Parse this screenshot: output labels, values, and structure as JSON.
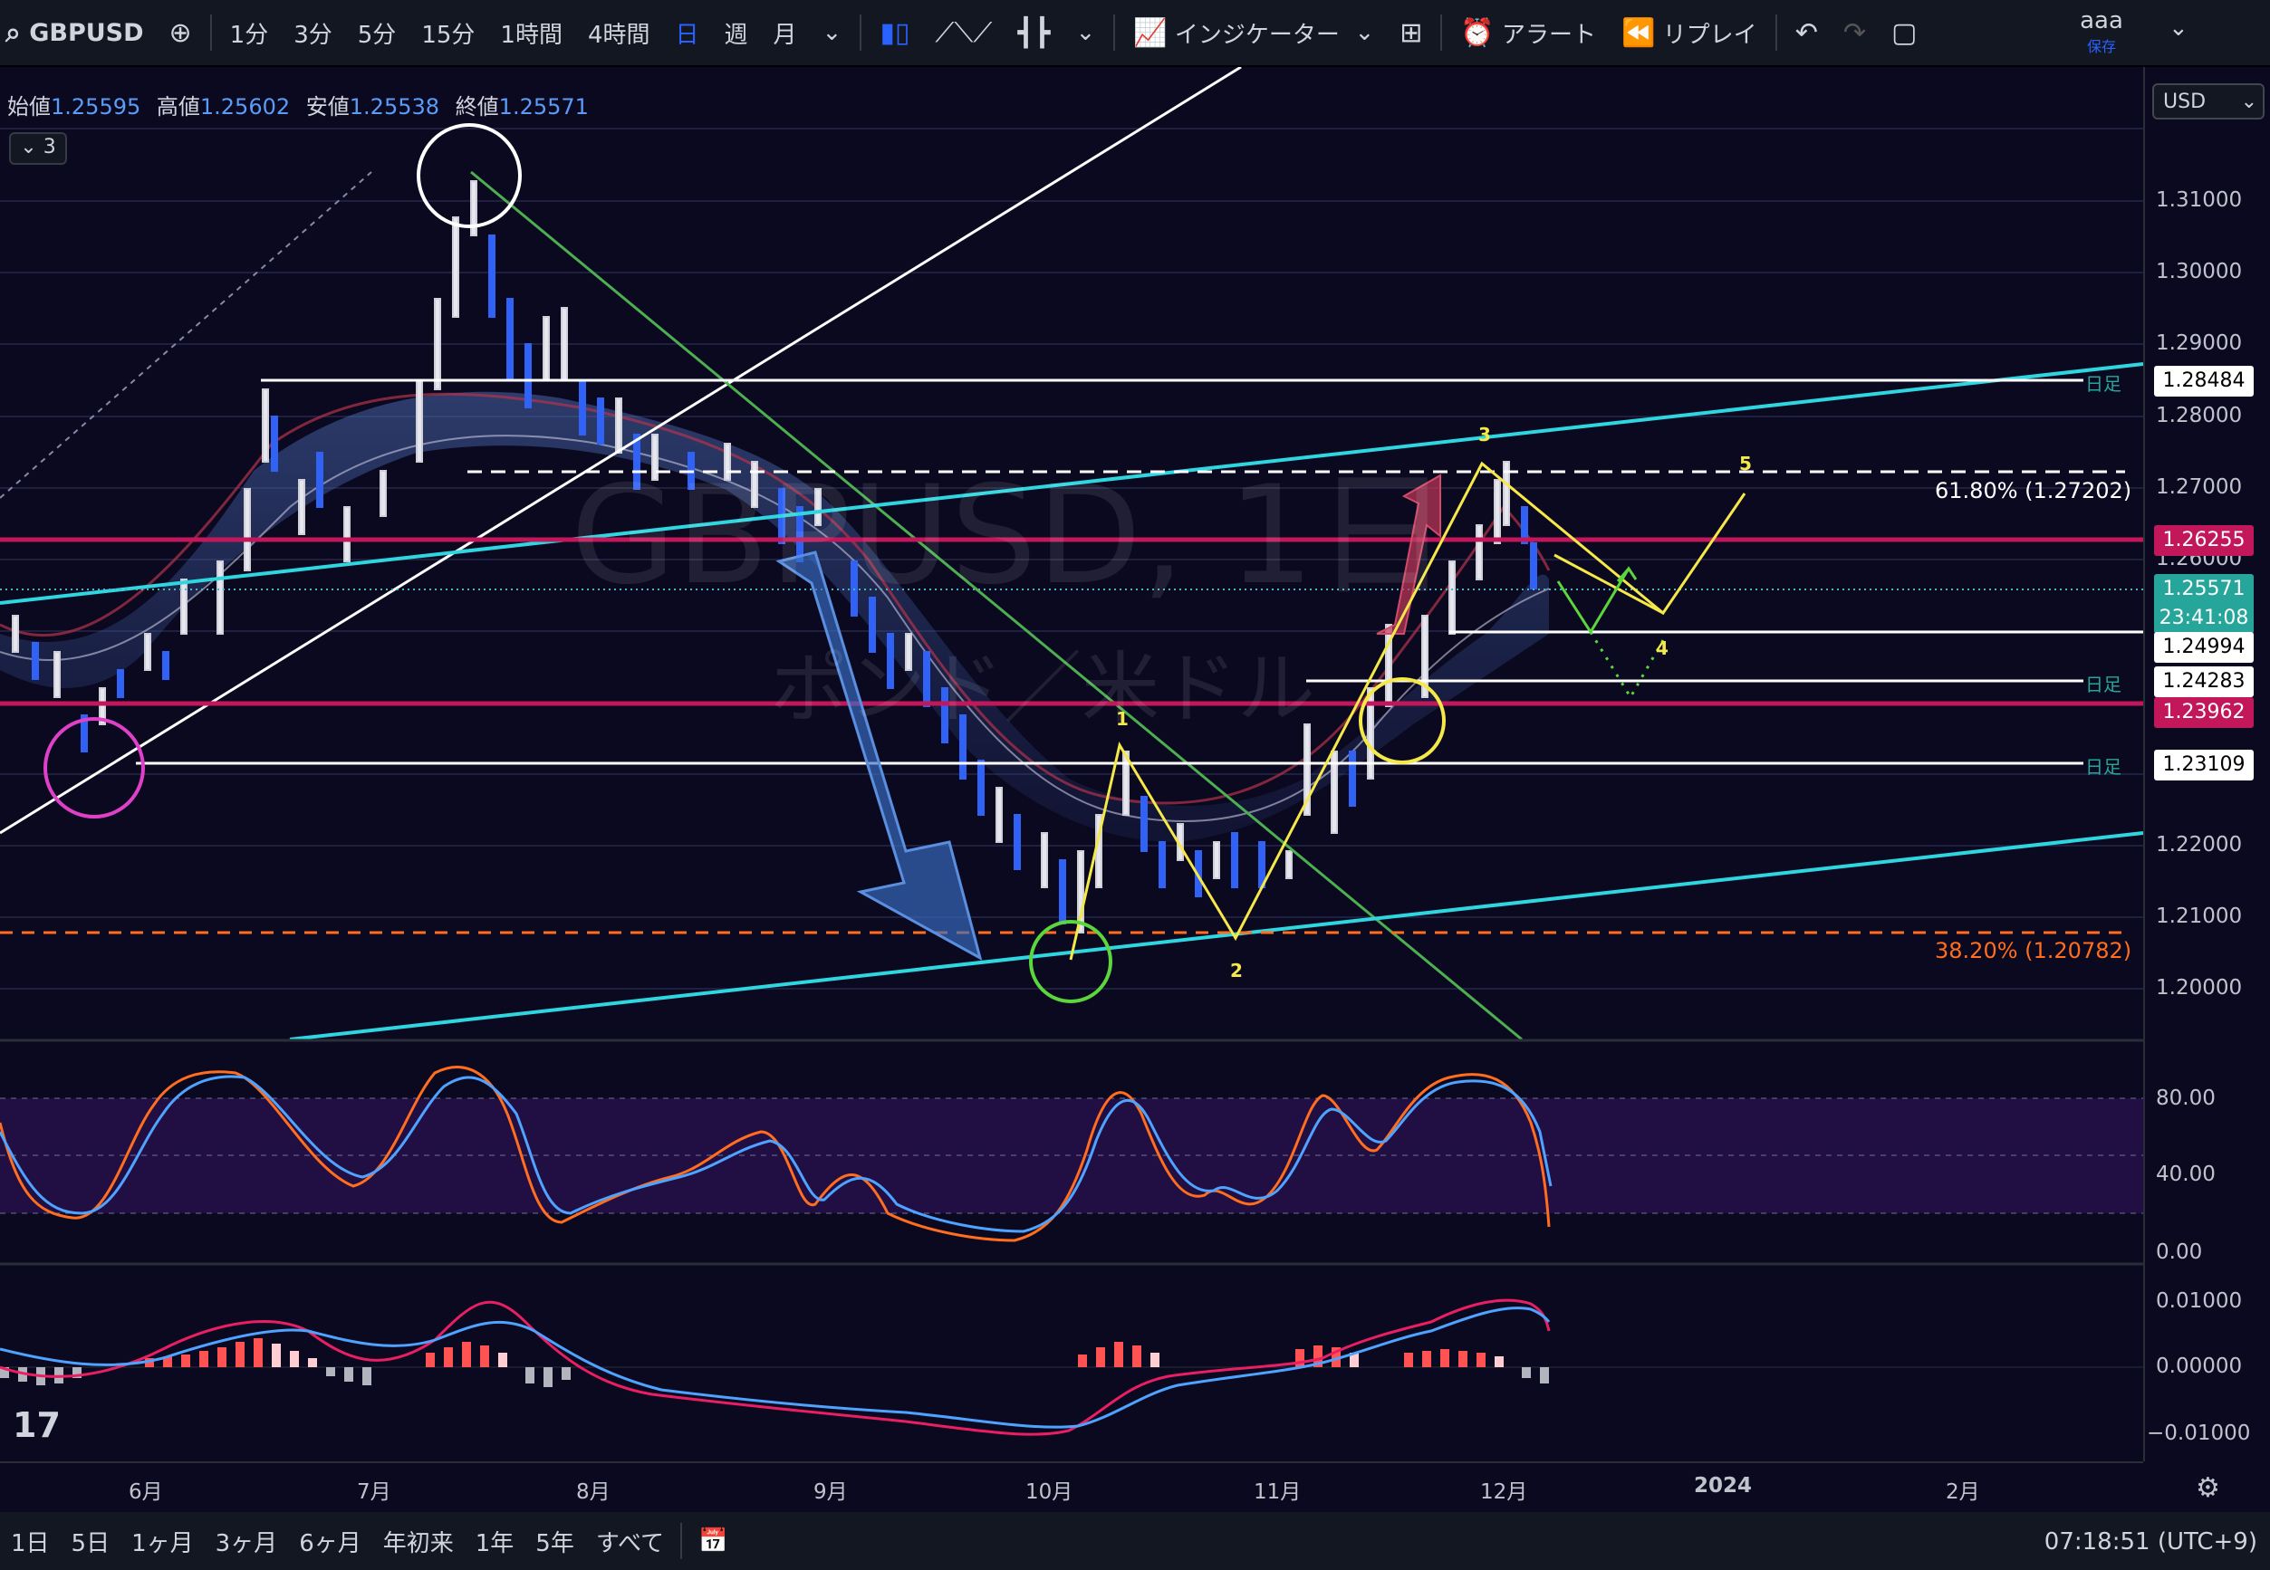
{
  "toolbar": {
    "symbol": "GBPUSD",
    "intervals": [
      "1分",
      "3分",
      "5分",
      "15分",
      "1時間",
      "4時間",
      "日",
      "週",
      "月"
    ],
    "active_interval": "日",
    "indicators_label": "インジケーター",
    "alert_label": "アラート",
    "replay_label": "リプレイ",
    "user": "aaa",
    "save_label": "保存"
  },
  "ohlc": {
    "open_label": "始値",
    "open": "1.25595",
    "high_label": "高値",
    "high": "1.25602",
    "low_label": "安値",
    "low": "1.25538",
    "close_label": "終値",
    "close": "1.25571"
  },
  "collapse_count": "3",
  "currency": "USD",
  "watermark": {
    "symbol": "GBPUSD, 1日",
    "name": "ポンド／米ドル"
  },
  "price_ticks": [
    "1.31000",
    "1.30000",
    "1.29000",
    "1.28000",
    "1.27000",
    "1.26000",
    "1.22000",
    "1.21000",
    "1.20000"
  ],
  "price_labels": [
    {
      "text": "1.28484",
      "bg": "#ffffff",
      "fg": "#000000"
    },
    {
      "text": "1.26255",
      "bg": "#c2185b",
      "fg": "#ffffff"
    },
    {
      "text": "1.25571",
      "bg": "#26a69a",
      "fg": "#ffffff"
    },
    {
      "text": "23:41:08",
      "bg": "#26a69a",
      "fg": "#ffffff"
    },
    {
      "text": "1.24994",
      "bg": "#ffffff",
      "fg": "#000000"
    },
    {
      "text": "1.24283",
      "bg": "#ffffff",
      "fg": "#000000"
    },
    {
      "text": "1.23962",
      "bg": "#c2185b",
      "fg": "#ffffff"
    },
    {
      "text": "1.23109",
      "bg": "#ffffff",
      "fg": "#000000"
    }
  ],
  "daily_tag": "日足",
  "fib_labels": {
    "f618": "61.80% (1.27202)",
    "f382": "38.20% (1.20782)"
  },
  "wave_labels": [
    "1",
    "2",
    "3",
    "4",
    "5"
  ],
  "stoch_ticks": [
    "80.00",
    "40.00",
    "0.00"
  ],
  "macd_ticks": [
    "0.01000",
    "0.00000",
    "−0.01000"
  ],
  "time_labels": [
    "6月",
    "7月",
    "8月",
    "9月",
    "10月",
    "11月",
    "12月",
    "2024",
    "2月"
  ],
  "ranges": [
    "1日",
    "5日",
    "1ヶ月",
    "3ヶ月",
    "6ヶ月",
    "年初来",
    "1年",
    "5年",
    "すべて"
  ],
  "clock": "07:18:51 (UTC+9)",
  "logo": "17",
  "colors": {
    "cyan": "#2fd6e0",
    "magenta": "#c2185b",
    "yellow": "#f5e94a",
    "green": "#5bd63c",
    "orange": "#ff6d1f"
  }
}
